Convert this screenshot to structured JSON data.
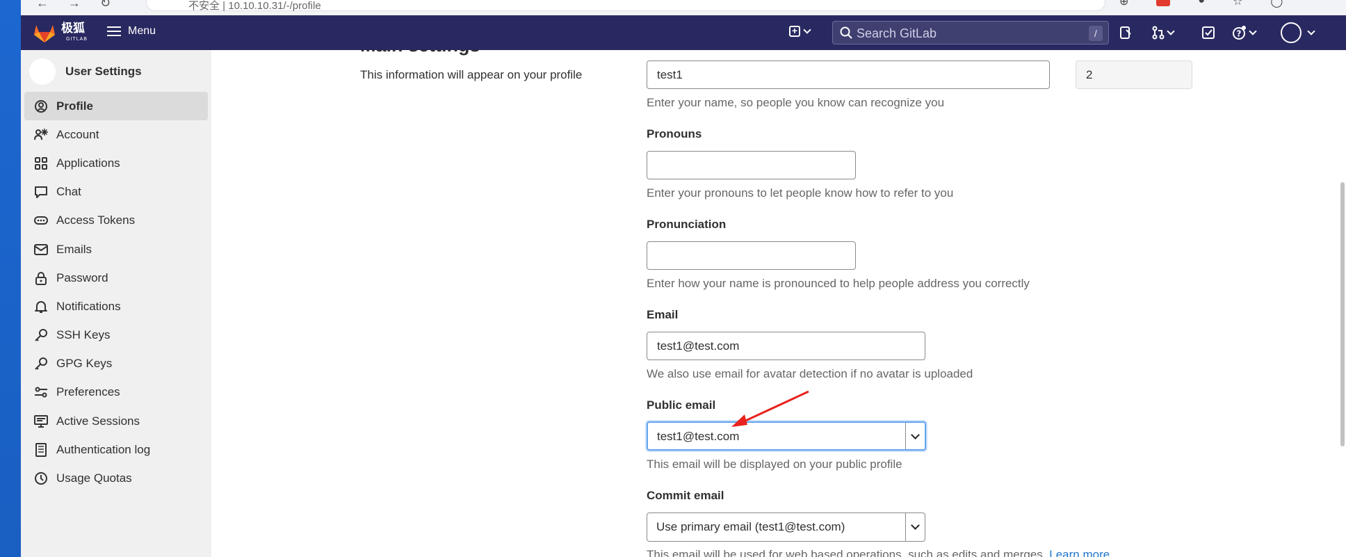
{
  "browser": {
    "address_text": "不安全 | 10.10.10.31/-/profile"
  },
  "topnav": {
    "logo_text": "极狐",
    "logo_sub": "GITLAB",
    "menu_label": "Menu",
    "search_placeholder": "Search GitLab",
    "search_shortcut": "/"
  },
  "sidebar": {
    "title": "User Settings",
    "items": [
      {
        "label": "Profile",
        "icon": "user-circle-icon",
        "active": true
      },
      {
        "label": "Account",
        "icon": "account-gear-icon"
      },
      {
        "label": "Applications",
        "icon": "applications-grid-icon"
      },
      {
        "label": "Chat",
        "icon": "chat-bubble-icon"
      },
      {
        "label": "Access Tokens",
        "icon": "token-icon"
      },
      {
        "label": "Emails",
        "icon": "envelope-icon"
      },
      {
        "label": "Password",
        "icon": "lock-icon"
      },
      {
        "label": "Notifications",
        "icon": "bell-icon"
      },
      {
        "label": "SSH Keys",
        "icon": "key-icon"
      },
      {
        "label": "GPG Keys",
        "icon": "key-icon"
      },
      {
        "label": "Preferences",
        "icon": "preferences-sliders-icon"
      },
      {
        "label": "Active Sessions",
        "icon": "monitor-icon"
      },
      {
        "label": "Authentication log",
        "icon": "log-list-icon"
      },
      {
        "label": "Usage Quotas",
        "icon": "quota-clock-icon"
      }
    ]
  },
  "main": {
    "section_title": "Main settings",
    "section_desc": "This information will appear on your profile",
    "name": {
      "value": "test1",
      "help": "Enter your name, so people you know can recognize you"
    },
    "user_id": {
      "value": "2"
    },
    "pronouns": {
      "label": "Pronouns",
      "value": "",
      "help": "Enter your pronouns to let people know how to refer to you"
    },
    "pronunciation": {
      "label": "Pronunciation",
      "value": "",
      "help": "Enter how your name is pronounced to help people address you correctly"
    },
    "email": {
      "label": "Email",
      "value": "test1@test.com",
      "help": "We also use email for avatar detection if no avatar is uploaded"
    },
    "public_email": {
      "label": "Public email",
      "value": "test1@test.com",
      "help": "This email will be displayed on your public profile"
    },
    "commit_email": {
      "label": "Commit email",
      "value": "Use primary email (test1@test.com)",
      "help": "This email will be used for web based operations, such as edits and merges.",
      "link": "Learn more"
    }
  },
  "colors": {
    "topnav_bg": "#292961",
    "sidebar_bg": "#f0f0f0",
    "accent_link": "#1f75cb",
    "annotation_arrow": "#e8231d"
  }
}
